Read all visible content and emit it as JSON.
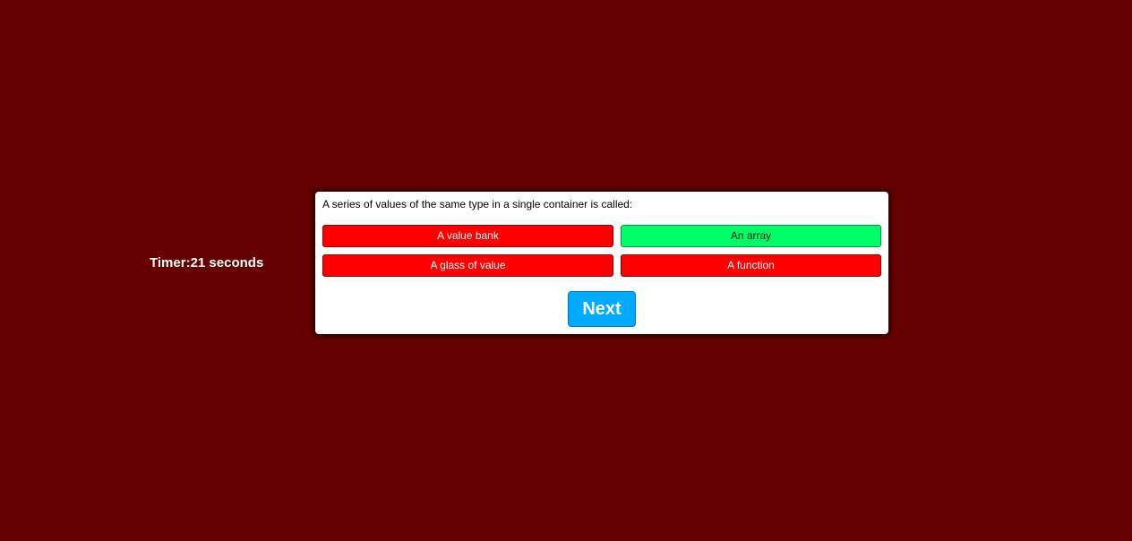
{
  "timer": {
    "label": "Timer:21 seconds"
  },
  "quiz": {
    "question": "A series of values of the same type in a single container is called:",
    "answers": [
      {
        "label": "A value bank",
        "state": "wrong"
      },
      {
        "label": "An array",
        "state": "correct"
      },
      {
        "label": "A glass of value",
        "state": "wrong"
      },
      {
        "label": "A function",
        "state": "wrong"
      }
    ],
    "next_label": "Next"
  },
  "colors": {
    "background": "#660000",
    "wrong_answer": "#ff0000",
    "correct_answer": "#00ff66",
    "next_button": "#00aaff"
  }
}
